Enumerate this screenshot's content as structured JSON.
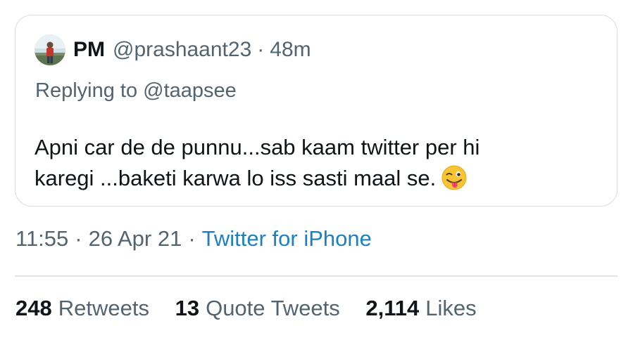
{
  "quoted_tweet": {
    "author": {
      "display_name": "PM",
      "handle": "@prashaant23",
      "separator": "·",
      "time_ago": "48m"
    },
    "replying_to": "Replying to @taapsee",
    "text_lines": [
      "Apni car de de punnu...sab kaam twitter per hi",
      "karegi ...baketi karwa lo iss sasti maal se."
    ],
    "emoji": "winking-face-with-tongue"
  },
  "meta": {
    "time": "11:55",
    "separator": "·",
    "date": "26 Apr 21",
    "source": "Twitter for iPhone"
  },
  "stats": [
    {
      "count": "248",
      "label": "Retweets"
    },
    {
      "count": "13",
      "label": "Quote Tweets"
    },
    {
      "count": "2,114",
      "label": "Likes"
    }
  ],
  "colors": {
    "text_primary": "#0f1419",
    "text_secondary": "#536471",
    "link": "#1d80c1",
    "border": "#d8dde1"
  }
}
